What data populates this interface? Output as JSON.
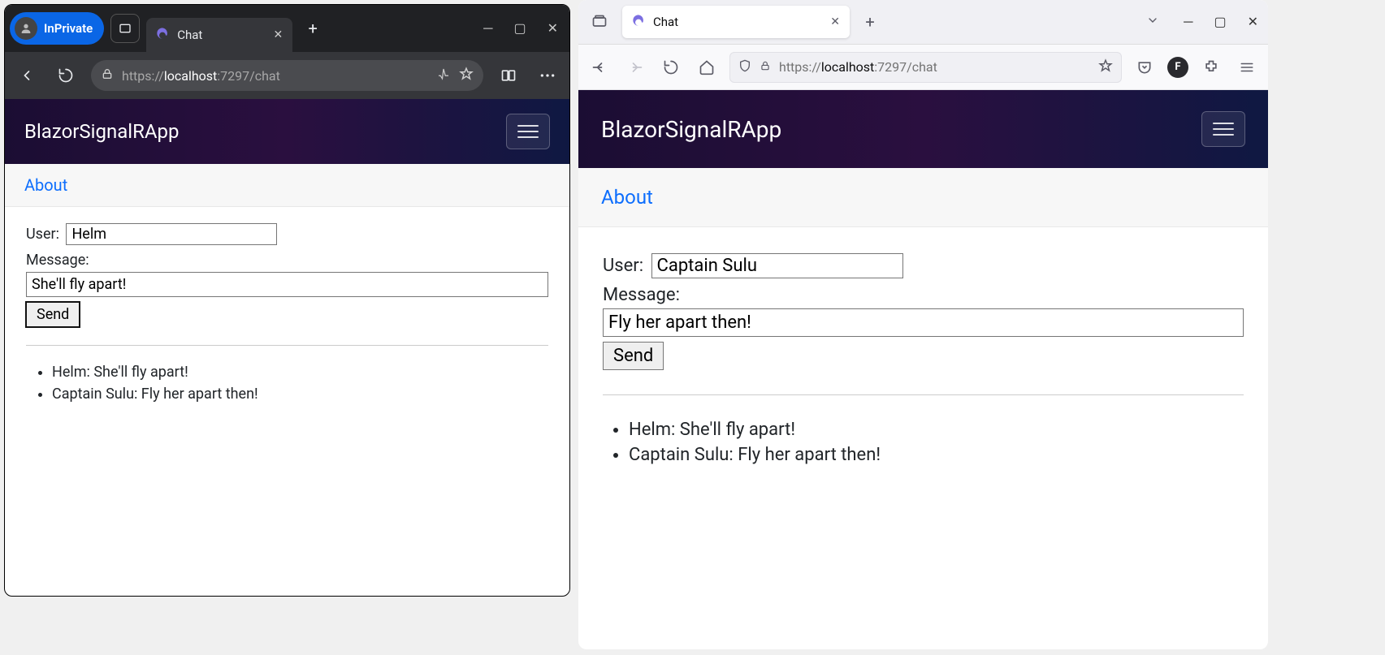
{
  "left": {
    "browser": "edge",
    "profile_label": "InPrivate",
    "tab_title": "Chat",
    "url_scheme": "https://",
    "url_host": "localhost",
    "url_port_path": ":7297/chat",
    "app_title": "BlazorSignalRApp",
    "about_label": "About",
    "user_label": "User:",
    "user_value": "Helm",
    "message_label": "Message:",
    "message_value": "She'll fly apart!",
    "send_label": "Send",
    "messages": [
      "Helm: She'll fly apart!",
      "Captain Sulu: Fly her apart then!"
    ]
  },
  "right": {
    "browser": "firefox",
    "profile_badge": "F",
    "tab_title": "Chat",
    "url_scheme": "https://",
    "url_host": "localhost",
    "url_port_path": ":7297/chat",
    "app_title": "BlazorSignalRApp",
    "about_label": "About",
    "user_label": "User:",
    "user_value": "Captain Sulu",
    "message_label": "Message:",
    "message_value": "Fly her apart then!",
    "send_label": "Send",
    "messages": [
      "Helm: She'll fly apart!",
      "Captain Sulu: Fly her apart then!"
    ]
  }
}
